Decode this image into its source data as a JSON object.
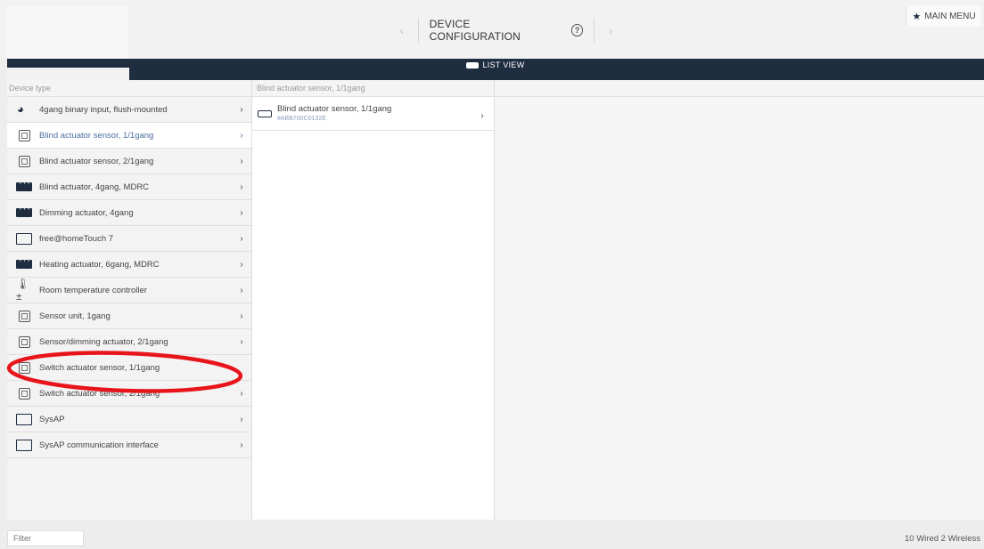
{
  "header": {
    "title": "DEVICE CONFIGURATION",
    "help_icon": "help-circle-icon",
    "prev_icon": "chevron-left-icon",
    "next_icon": "chevron-right-icon",
    "main_menu_label": "MAIN MENU",
    "main_menu_icon": "star-icon"
  },
  "view_bar": {
    "label": "LIST VIEW",
    "icon": "list-view-icon"
  },
  "columns": {
    "device_type_header": "Device type",
    "selected_type_header": "Blind actuator sensor, 1/1gang"
  },
  "device_types": [
    {
      "label": "4gang binary input, flush-mounted",
      "icon": "binary-input-icon"
    },
    {
      "label": "Blind actuator sensor, 1/1gang",
      "icon": "sensor-icon",
      "selected": true
    },
    {
      "label": "Blind actuator sensor, 2/1gang",
      "icon": "sensor-icon"
    },
    {
      "label": "Blind actuator, 4gang, MDRC",
      "icon": "mdrc-icon"
    },
    {
      "label": "Dimming actuator, 4gang",
      "icon": "mdrc-icon"
    },
    {
      "label": "free@homeTouch 7",
      "icon": "panel-icon"
    },
    {
      "label": "Heating actuator, 6gang, MDRC",
      "icon": "mdrc-icon"
    },
    {
      "label": "Room temperature controller",
      "icon": "thermostat-icon"
    },
    {
      "label": "Sensor unit, 1gang",
      "icon": "sensor-icon"
    },
    {
      "label": "Sensor/dimming actuator, 2/1gang",
      "icon": "sensor-icon"
    },
    {
      "label": "Switch actuator sensor, 1/1gang",
      "icon": "sensor-icon"
    },
    {
      "label": "Switch actuator sensor, 2/1gang",
      "icon": "sensor-icon"
    },
    {
      "label": "SysAP",
      "icon": "panel-icon"
    },
    {
      "label": "SysAP communication interface",
      "icon": "panel-icon"
    }
  ],
  "devices": [
    {
      "name": "Blind actuator sensor, 1/1gang",
      "id": "#ABB700C0132E",
      "icon": "device-icon"
    }
  ],
  "footer": {
    "filter_placeholder": "Filter",
    "status": "10 Wired  2 Wireless"
  },
  "colors": {
    "navbar": "#1f2d40",
    "annotation": "#e8141b",
    "selected_text": "#4a6fa0"
  }
}
